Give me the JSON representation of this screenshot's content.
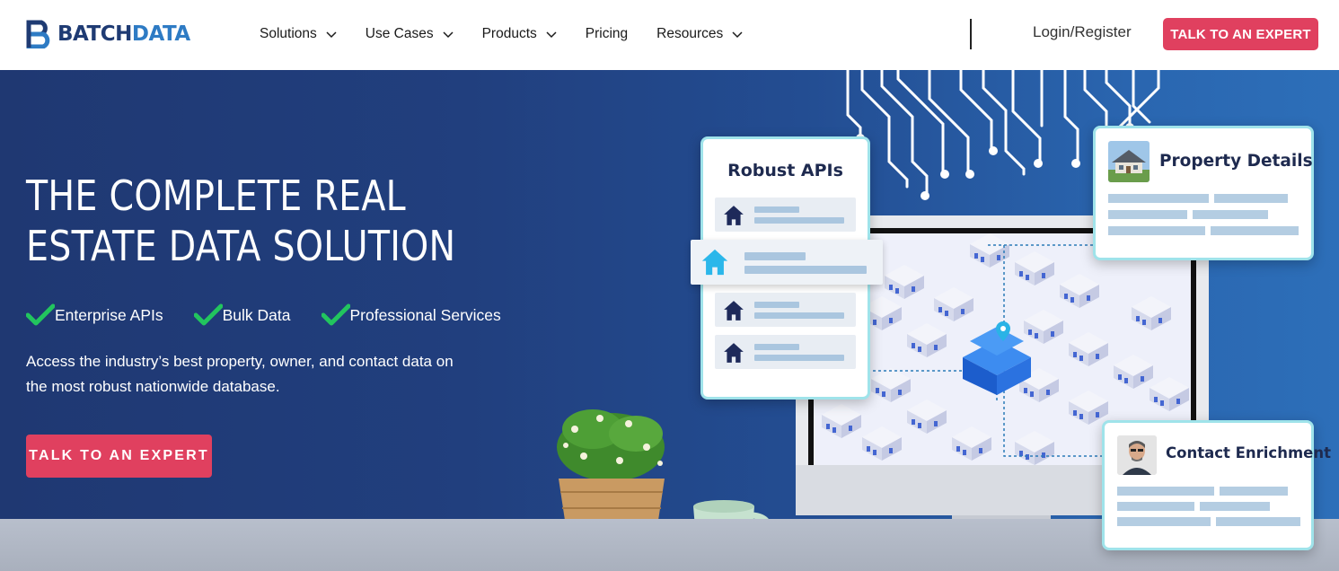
{
  "brand": {
    "name_part1": "BATCH",
    "name_part2": "DATA"
  },
  "nav": {
    "menu": [
      {
        "label": "Solutions",
        "has_dropdown": true
      },
      {
        "label": "Use Cases",
        "has_dropdown": true
      },
      {
        "label": "Products",
        "has_dropdown": true
      },
      {
        "label": "Pricing",
        "has_dropdown": false
      },
      {
        "label": "Resources",
        "has_dropdown": true
      }
    ],
    "login_label": "Login/Register",
    "cta_label": "TALK TO AN EXPERT"
  },
  "hero": {
    "title_line1": "THE COMPLETE REAL",
    "title_line2": "ESTATE DATA SOLUTION",
    "features": [
      "Enterprise APIs",
      "Bulk Data",
      "Professional Services"
    ],
    "description_line1": "Access the industry’s best property, owner, and contact data on",
    "description_line2": "the most robust nationwide database.",
    "cta_label": "TALK TO AN EXPERT"
  },
  "illustration": {
    "card_apis_title": "Robust APIs",
    "card_property_title": "Property Details",
    "card_contact_title": "Contact Enrichment"
  },
  "colors": {
    "brand_dark": "#1f3b73",
    "brand_light": "#2e7bc4",
    "cta": "#e0405f",
    "check": "#22c55e",
    "card_border": "#9fe3ea"
  },
  "icons": [
    "batchdata-logo-icon",
    "chevron-down-icon",
    "checkmark-icon",
    "house-icon",
    "map-pin-icon"
  ]
}
